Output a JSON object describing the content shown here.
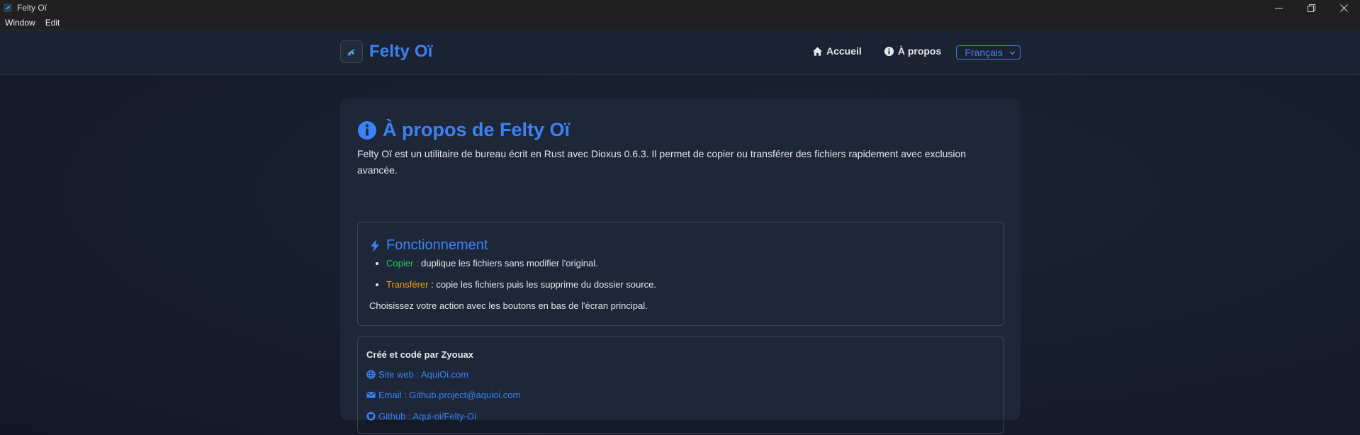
{
  "window": {
    "title": "Felty Oï",
    "menu": [
      "Window",
      "Edit"
    ]
  },
  "navbar": {
    "brand": "Felty Oï",
    "links": [
      {
        "label": "Accueil",
        "icon": "home-icon"
      },
      {
        "label": "À propos",
        "icon": "info-icon"
      }
    ],
    "language": "Français"
  },
  "about": {
    "title": "À propos de Felty Oï",
    "intro": "Felty Oï est un utilitaire de bureau écrit en Rust avec Dioxus 0.6.3. Il permet de copier ou transférer des fichiers rapidement avec exclusion avancée.",
    "how": {
      "heading": "Fonctionnement",
      "items": [
        {
          "term": "Copier :",
          "desc": " duplique les fichiers sans modifier l'original."
        },
        {
          "term": "Transférer",
          "desc": " : copie les fichiers puis les supprime du dossier source."
        }
      ],
      "note": "Choisissez votre action avec les boutons en bas de l'écran principal."
    },
    "credits": {
      "author": "Créé et codé par Zyouax",
      "links": [
        {
          "text": "Site web : AquiOi.com",
          "icon": "globe-icon"
        },
        {
          "text": "Email : Github.project@aquioi.com",
          "icon": "envelope-icon"
        },
        {
          "text": "Github : Aqui-oi/Felty-Oi",
          "icon": "github-icon"
        }
      ]
    }
  },
  "colors": {
    "accent": "#3b82f6",
    "copy": "#22c55e",
    "transfer": "#f59e0b"
  }
}
